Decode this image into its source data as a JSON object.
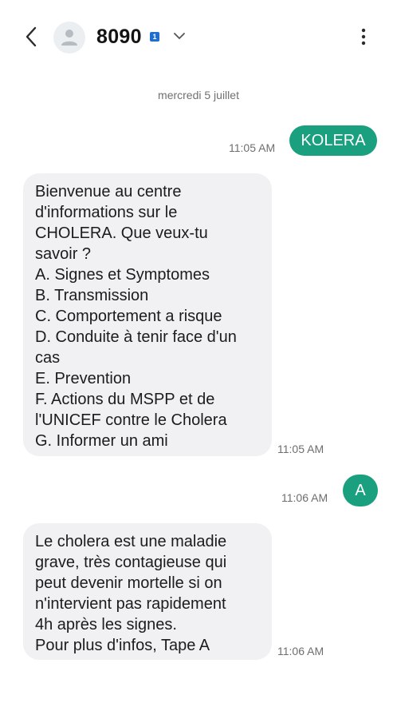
{
  "header": {
    "contact_name": "8090",
    "sim_badge": "1",
    "icons": {
      "back": "back-arrow-icon",
      "avatar": "person-avatar-icon",
      "expand": "chevron-down-icon",
      "menu": "more-vertical-icon"
    }
  },
  "conversation": {
    "date_separator": "mercredi 5 juillet",
    "messages": [
      {
        "direction": "outgoing",
        "text": "KOLERA",
        "time": "11:05 AM"
      },
      {
        "direction": "incoming",
        "text": "Bienvenue au centre\nd'informations sur le\nCHOLERA. Que veux-tu\nsavoir ?\nA. Signes et Symptomes\nB. Transmission\nC. Comportement a risque\nD. Conduite à tenir face d'un\ncas\nE. Prevention\nF. Actions du MSPP et de\nl'UNICEF contre le Cholera\nG. Informer un ami",
        "time": "11:05 AM"
      },
      {
        "direction": "outgoing",
        "text": "A",
        "time": "11:06 AM"
      },
      {
        "direction": "incoming",
        "text": "Le cholera est une maladie\ngrave, très contagieuse qui\npeut devenir mortelle si on\nn'intervient pas rapidement\n4h après les signes.\n Pour plus d'infos, Tape A",
        "time": "11:06 AM"
      }
    ]
  },
  "colors": {
    "outgoing_bubble": "#1aa07f",
    "incoming_bubble": "#f1f1f3",
    "sim_badge": "#1f6fd1"
  }
}
